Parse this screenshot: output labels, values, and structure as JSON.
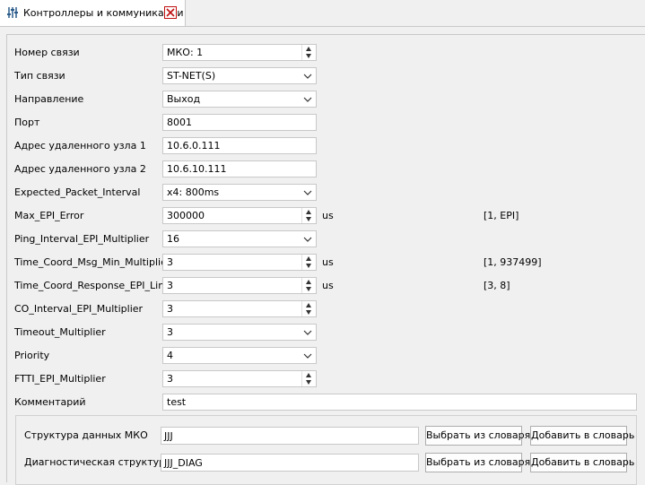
{
  "tab": {
    "title": "Контроллеры и коммуникации"
  },
  "rows": [
    {
      "label": "Номер связи",
      "value": "МКО: 1",
      "control": "spin"
    },
    {
      "label": "Тип связи",
      "value": "ST-NET(S)",
      "control": "combo"
    },
    {
      "label": "Направление",
      "value": "Выход",
      "control": "combo"
    },
    {
      "label": "Порт",
      "value": "8001",
      "control": "text"
    },
    {
      "label": "Адрес удаленного узла 1",
      "value": "10.6.0.111",
      "control": "text"
    },
    {
      "label": "Адрес удаленного узла 2",
      "value": "10.6.10.111",
      "control": "text"
    },
    {
      "label": "Expected_Packet_Interval",
      "value": "x4: 800ms",
      "control": "combo"
    },
    {
      "label": "Max_EPI_Error",
      "value": "300000",
      "control": "spin",
      "unit": "us",
      "range": "[1, EPI]"
    },
    {
      "label": "Ping_Interval_EPI_Multiplier",
      "value": "16",
      "control": "combo"
    },
    {
      "label": "Time_Coord_Msg_Min_Multiplier",
      "value": "3",
      "control": "spin",
      "unit": "us",
      "range": "[1, 937499]"
    },
    {
      "label": "Time_Coord_Response_EPI_Limit",
      "value": "3",
      "control": "spin",
      "unit": "us",
      "range": "[3, 8]"
    },
    {
      "label": "CO_Interval_EPI_Multiplier",
      "value": "3",
      "control": "spin"
    },
    {
      "label": "Timeout_Multiplier",
      "value": "3",
      "control": "combo"
    },
    {
      "label": "Priority",
      "value": "4",
      "control": "combo"
    },
    {
      "label": "FTTI_EPI_Multiplier",
      "value": "3",
      "control": "spin"
    },
    {
      "label": "Комментарий",
      "value": "test",
      "control": "wide"
    }
  ],
  "structures": [
    {
      "label": "Структура данных МКО",
      "value": "JJJ",
      "pick_label": "Выбрать из словаря",
      "add_label": "Добавить в словарь"
    },
    {
      "label": "Диагностическая структура",
      "value": "JJJ_DIAG",
      "pick_label": "Выбрать из словаря",
      "add_label": "Добавить в словарь"
    }
  ],
  "colors": {
    "close_icon": "#c01010",
    "border": "#c8c8c8",
    "background": "#f0f0f0"
  }
}
